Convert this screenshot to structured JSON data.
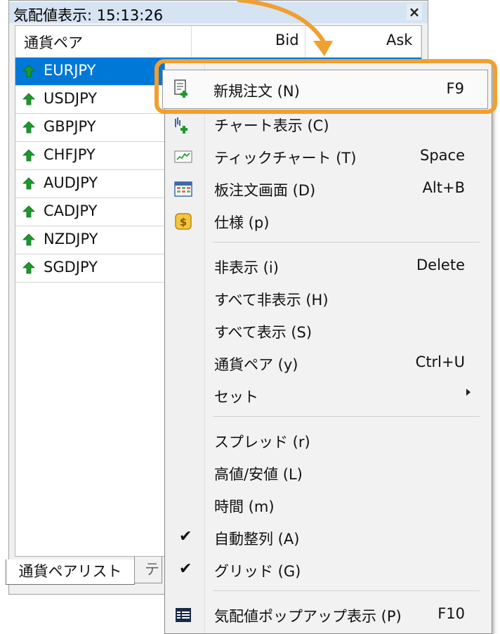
{
  "market_watch": {
    "title": "気配値表示: 15:13:26",
    "close_glyph": "×",
    "columns": [
      "通貨ペア",
      "Bid",
      "Ask"
    ],
    "symbols": [
      {
        "name": "EURJPY",
        "selected": true
      },
      {
        "name": "USDJPY",
        "selected": false
      },
      {
        "name": "GBPJPY",
        "selected": false
      },
      {
        "name": "CHFJPY",
        "selected": false
      },
      {
        "name": "AUDJPY",
        "selected": false
      },
      {
        "name": "CADJPY",
        "selected": false
      },
      {
        "name": "NZDJPY",
        "selected": false
      },
      {
        "name": "SGDJPY",
        "selected": false
      }
    ],
    "tabs": [
      "通貨ペアリスト",
      "テ"
    ]
  },
  "context_menu": {
    "items": [
      {
        "label": "新規注文 (N)",
        "shortcut": "F9",
        "icon": "new-order-icon"
      },
      {
        "label": "チャート表示 (C)",
        "shortcut": "",
        "icon": "chart-window-icon"
      },
      {
        "label": "ティックチャート (T)",
        "shortcut": "Space",
        "icon": "tick-chart-icon"
      },
      {
        "label": "板注文画面 (D)",
        "shortcut": "Alt+B",
        "icon": "depth-of-market-icon"
      },
      {
        "label": "仕様 (p)",
        "shortcut": "",
        "icon": "specification-icon"
      },
      {
        "label": "非表示 (i)",
        "shortcut": "Delete"
      },
      {
        "label": "すべて非表示 (H)",
        "shortcut": ""
      },
      {
        "label": "すべて表示 (S)",
        "shortcut": ""
      },
      {
        "label": "通貨ペア (y)",
        "shortcut": "Ctrl+U"
      },
      {
        "label": "セット",
        "shortcut": "",
        "submenu": true
      },
      {
        "label": "スプレッド (r)",
        "shortcut": ""
      },
      {
        "label": "高値/安値 (L)",
        "shortcut": ""
      },
      {
        "label": "時間 (m)",
        "shortcut": ""
      },
      {
        "label": "自動整列 (A)",
        "shortcut": "",
        "checked": true
      },
      {
        "label": "グリッド (G)",
        "shortcut": "",
        "checked": true
      },
      {
        "label": "気配値ポップアップ表示 (P)",
        "shortcut": "F10",
        "icon": "popup-prices-icon"
      }
    ]
  },
  "colors": {
    "highlight": "#f0a030",
    "selection": "#0078d7",
    "up_arrow": "#1a9a2a"
  }
}
